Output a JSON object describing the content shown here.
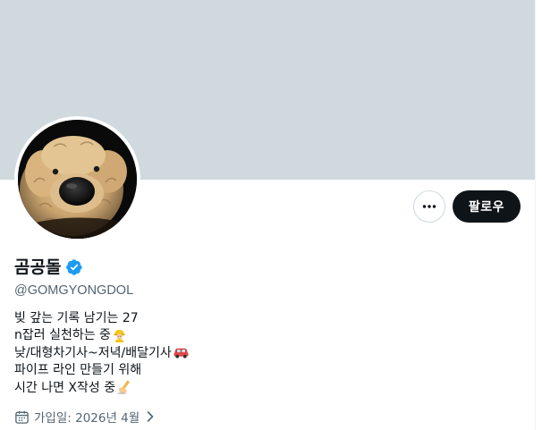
{
  "profile": {
    "display_name": "곰공돌",
    "handle": "@GOMGYONGDOL",
    "verified": true,
    "bio_lines": [
      "빚 갚는 기록 남기는 27",
      "n잡러 실천하는 중",
      "낮/대형차기사~저녁/배달기사",
      "파이프 라인 만들기 위해",
      "시간 나면 X작성 중"
    ],
    "bio_emojis": [
      "",
      "construction-worker-emoji",
      "car-emoji",
      "",
      "writing-hand-emoji"
    ],
    "joined": "가입일: 2026년 4월"
  },
  "actions": {
    "more_icon": "more-horizontal-icon",
    "follow_label": "팔로우"
  },
  "colors": {
    "banner": "#cfd9de",
    "primary_text": "#0f1419",
    "secondary_text": "#536471",
    "verified_blue": "#1d9bf0",
    "follow_button_bg": "#0f1419",
    "border": "#cfd9de"
  }
}
